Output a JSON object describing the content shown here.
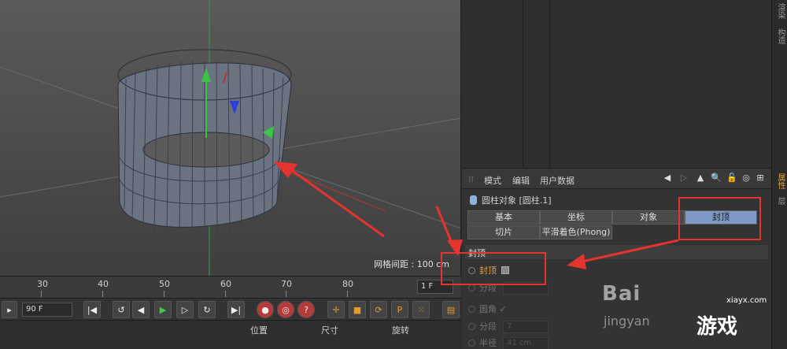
{
  "viewport": {
    "grid_spacing_label": "网格间距 : 100 cm"
  },
  "timeline": {
    "ticks": [
      "30",
      "40",
      "50",
      "60",
      "70",
      "80"
    ],
    "current_frame": "1 F"
  },
  "transport": {
    "end_frame": "90 F",
    "buttons": [
      "first-frame-icon",
      "prev-key-icon",
      "step-back-icon",
      "play-icon",
      "step-forward-icon",
      "next-key-icon",
      "last-frame-icon",
      "record-icon",
      "autokey-icon",
      "keyframe-icon",
      "move-icon",
      "scale-icon",
      "rotate-icon",
      "param-icon",
      "points-icon",
      "film-icon"
    ]
  },
  "coordinates": {
    "headers": [
      "位置",
      "尺寸",
      "旋转"
    ]
  },
  "attributes": {
    "menu": [
      "模式",
      "编辑",
      "用户数据"
    ],
    "object_line": "圆柱对象 [圆柱.1]",
    "tabs_row1": [
      "基本",
      "坐标",
      "对象",
      "封顶"
    ],
    "tabs_row2": [
      "切片",
      "平滑着色(Phong)"
    ],
    "active_tab": "封顶",
    "section_title": "封顶",
    "props": [
      {
        "label": "封顶",
        "value": ""
      },
      {
        "label": "分段",
        "value": ""
      },
      {
        "label": "圆角",
        "value": "✓"
      },
      {
        "label": "分段",
        "value": "7"
      },
      {
        "label": "半径",
        "value": "41 cm"
      }
    ]
  },
  "side_tabs": [
    "渲染",
    "构造",
    "属性",
    "层"
  ],
  "watermark": {
    "brand": "Bai",
    "sub": "jingyan",
    "site": "xiayx.com",
    "game": "游戏"
  },
  "colors": {
    "accent_orange": "#e3a23a",
    "active_tab_blue": "#7d98c4",
    "annotation_red": "#e5332f"
  }
}
